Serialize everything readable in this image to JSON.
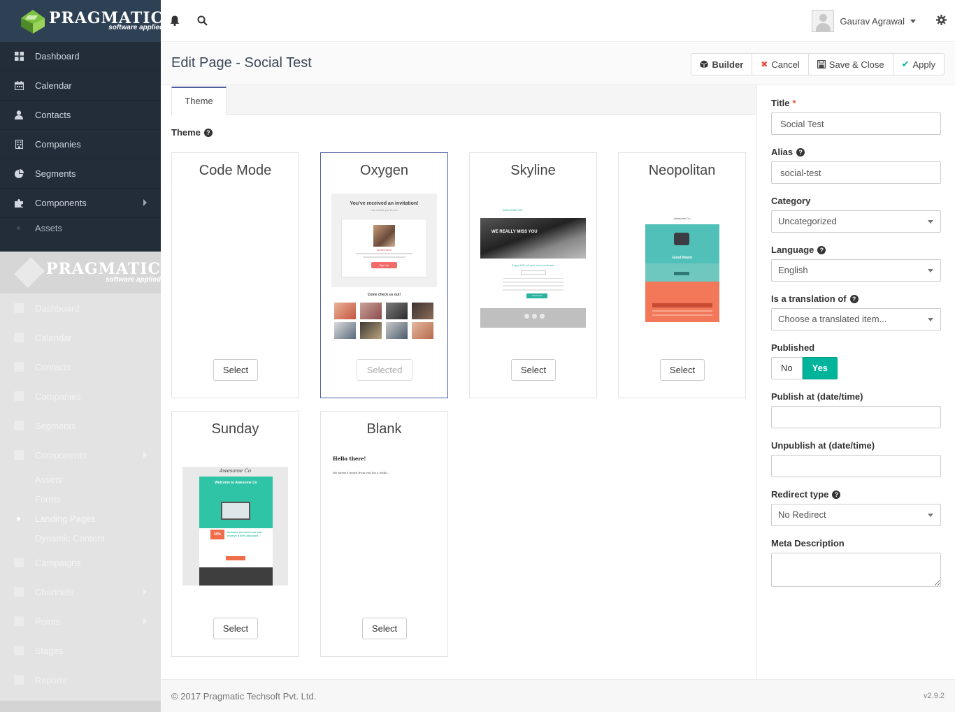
{
  "brand": {
    "name": "PRAGMATIC",
    "tagline": "software applied"
  },
  "sidebar": {
    "items": [
      {
        "label": "Dashboard",
        "icon": "th-large-icon"
      },
      {
        "label": "Calendar",
        "icon": "calendar-icon"
      },
      {
        "label": "Contacts",
        "icon": "user-icon"
      },
      {
        "label": "Companies",
        "icon": "building-icon"
      },
      {
        "label": "Segments",
        "icon": "pie-chart-icon"
      },
      {
        "label": "Components",
        "icon": "puzzle-icon"
      }
    ],
    "subitems": [
      {
        "label": "Assets"
      }
    ]
  },
  "ghost_sidebar": {
    "items": [
      "Dashboard",
      "Calendar",
      "Contacts",
      "Companies",
      "Segments",
      "Components"
    ],
    "subitems": [
      "Assets",
      "Forms",
      "Landing Pages",
      "Dynamic Content"
    ],
    "items2": [
      "Campaigns",
      "Channels",
      "Points",
      "Stages",
      "Reports"
    ],
    "user": "Gaurav Agrawal"
  },
  "topbar": {
    "user_name": "Gaurav Agrawal"
  },
  "header": {
    "title": "Edit Page - Social Test",
    "actions": {
      "builder": "Builder",
      "cancel": "Cancel",
      "save_close": "Save & Close",
      "apply": "Apply"
    }
  },
  "tabs": {
    "theme": "Theme"
  },
  "theme": {
    "label": "Theme",
    "cards": [
      {
        "name": "Code Mode",
        "button": "Select",
        "selected": false
      },
      {
        "name": "Oxygen",
        "button": "Selected",
        "selected": true
      },
      {
        "name": "Skyline",
        "button": "Select",
        "selected": false
      },
      {
        "name": "Neopolitan",
        "button": "Select",
        "selected": false
      },
      {
        "name": "Sunday",
        "button": "Select",
        "selected": false
      },
      {
        "name": "Blank",
        "button": "Select",
        "selected": false
      }
    ],
    "oxygen": {
      "heading": "You've received an invitation!",
      "name": "@username",
      "cta": "Sign Up",
      "section": "Come check us out!"
    },
    "skyline": {
      "brand": "AWESOME INC",
      "hero": "WE REALLY MISS YOU",
      "offer": "Enjoy 50% off your next purchase!",
      "button": "Download"
    },
    "neopolitan": {
      "brand": "Awesome Co",
      "headline": "Good News!"
    },
    "sunday": {
      "brand": "Awesome Co",
      "headline": "Welcome to Awesome Co",
      "badge": "50%",
      "offer": "Activate account now and receive a 50% discount"
    },
    "blank": {
      "heading": "Hello there!",
      "body": "We haven't heard from you for a while..."
    }
  },
  "form": {
    "title_label": "Title",
    "title_value": "Social Test",
    "alias_label": "Alias",
    "alias_value": "social-test",
    "category_label": "Category",
    "category_value": "Uncategorized",
    "language_label": "Language",
    "language_value": "English",
    "translation_label": "Is a translation of",
    "translation_placeholder": "Choose a translated item...",
    "published_label": "Published",
    "published_no": "No",
    "published_yes": "Yes",
    "publish_at_label": "Publish at (date/time)",
    "unpublish_at_label": "Unpublish at (date/time)",
    "redirect_label": "Redirect type",
    "redirect_value": "No Redirect",
    "meta_label": "Meta Description"
  },
  "footer": {
    "copyright": "© 2017 Pragmatic Techsoft Pvt. Ltd.",
    "version": "v2.9.2"
  },
  "colors": {
    "sidebar": "#232d3a",
    "logo_bg": "#2e4154",
    "accent": "#00b49c",
    "selected_border": "#4e5e9e",
    "required": "#e74c3c"
  }
}
